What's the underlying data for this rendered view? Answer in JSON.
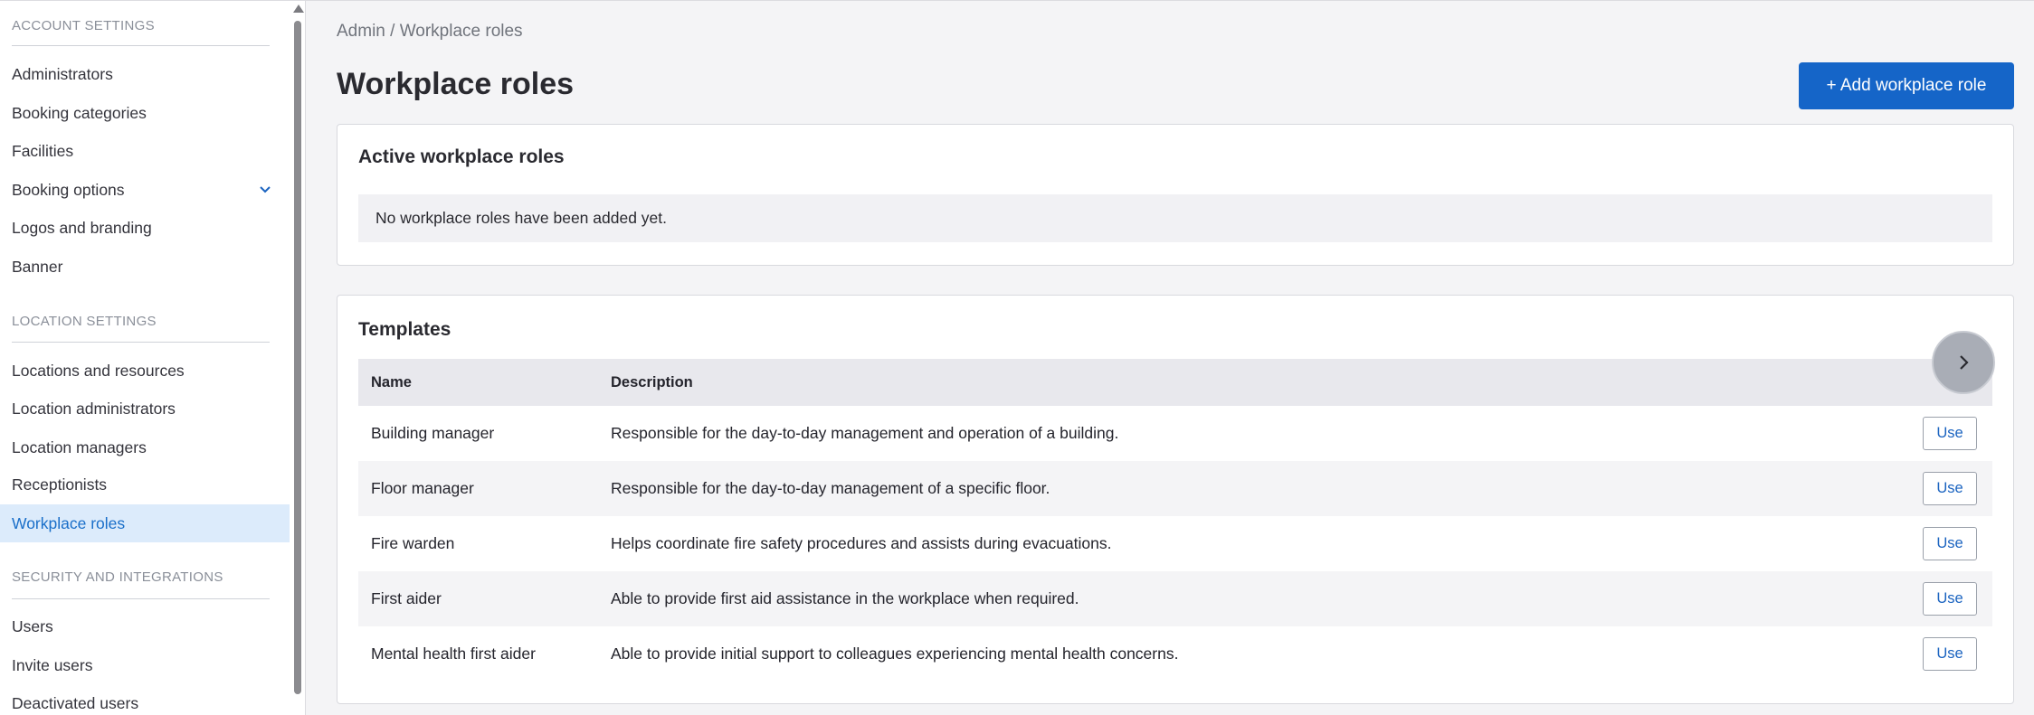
{
  "sidebar": {
    "sections": [
      {
        "title": "ACCOUNT SETTINGS"
      },
      {
        "title": "LOCATION SETTINGS"
      },
      {
        "title": "SECURITY AND INTEGRATIONS"
      }
    ],
    "account_items": [
      {
        "label": "Administrators"
      },
      {
        "label": "Booking categories"
      },
      {
        "label": "Facilities"
      },
      {
        "label": "Booking options"
      },
      {
        "label": "Logos and branding"
      },
      {
        "label": "Banner"
      }
    ],
    "location_items": [
      {
        "label": "Locations and resources"
      },
      {
        "label": "Location administrators"
      },
      {
        "label": "Location managers"
      },
      {
        "label": "Receptionists"
      },
      {
        "label": "Workplace roles"
      }
    ],
    "security_items": [
      {
        "label": "Users"
      },
      {
        "label": "Invite users"
      },
      {
        "label": "Deactivated users"
      }
    ],
    "active_item": "Workplace roles"
  },
  "header": {
    "breadcrumb": "Admin / Workplace roles",
    "title": "Workplace roles",
    "add_button_label": "+ Add workplace role"
  },
  "active_roles": {
    "title": "Active workplace roles",
    "empty_message": "No workplace roles have been added yet."
  },
  "templates": {
    "title": "Templates",
    "columns": [
      "Name",
      "Description"
    ],
    "rows": [
      {
        "name": "Building manager",
        "description": "Responsible for the day-to-day management and operation of a building.",
        "action": "Use"
      },
      {
        "name": "Floor manager",
        "description": "Responsible for the day-to-day management of a specific floor.",
        "action": "Use"
      },
      {
        "name": "Fire warden",
        "description": "Helps coordinate fire safety procedures and assists during evacuations.",
        "action": "Use"
      },
      {
        "name": "First aider",
        "description": "Able to provide first aid assistance in the workplace when required.",
        "action": "Use"
      },
      {
        "name": "Mental health first aider",
        "description": "Able to provide initial support to colleagues experiencing mental health concerns.",
        "action": "Use"
      }
    ]
  },
  "colors": {
    "primary": "#1565c8",
    "active_nav_bg": "#dcebfb",
    "active_nav_text": "#1a6fc9"
  },
  "icons": {
    "nav_expand": "chevron-down-icon",
    "fab": "chevron-right-icon",
    "scroll_up": "scroll-up-arrow-icon"
  }
}
